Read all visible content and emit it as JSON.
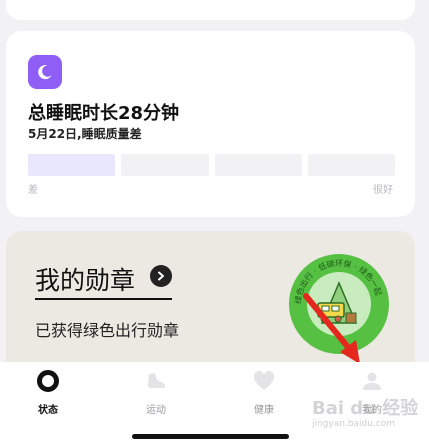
{
  "sleep": {
    "title": "总睡眠时长28分钟",
    "subtitle": "5月22日,睡眠质量差",
    "scale_low": "差",
    "scale_high": "很好",
    "quality_segments": 4,
    "quality_level": 1,
    "accent": "#8f5ef6"
  },
  "badges": {
    "title": "我的勋章",
    "subtitle": "已获得绿色出行勋章",
    "medal_ring_text": "绿色出行 · 低碳环保 · 绿色一起"
  },
  "tabbar": {
    "tabs": [
      {
        "label": "状态",
        "icon": "ring-icon",
        "active": true
      },
      {
        "label": "运动",
        "icon": "shoe-icon",
        "active": false
      },
      {
        "label": "健康",
        "icon": "heart-icon",
        "active": false
      },
      {
        "label": "我的",
        "icon": "person-icon",
        "active": false
      }
    ]
  },
  "watermark": {
    "text": "Bai du 经验",
    "url": "jingyan.baidu.com"
  }
}
